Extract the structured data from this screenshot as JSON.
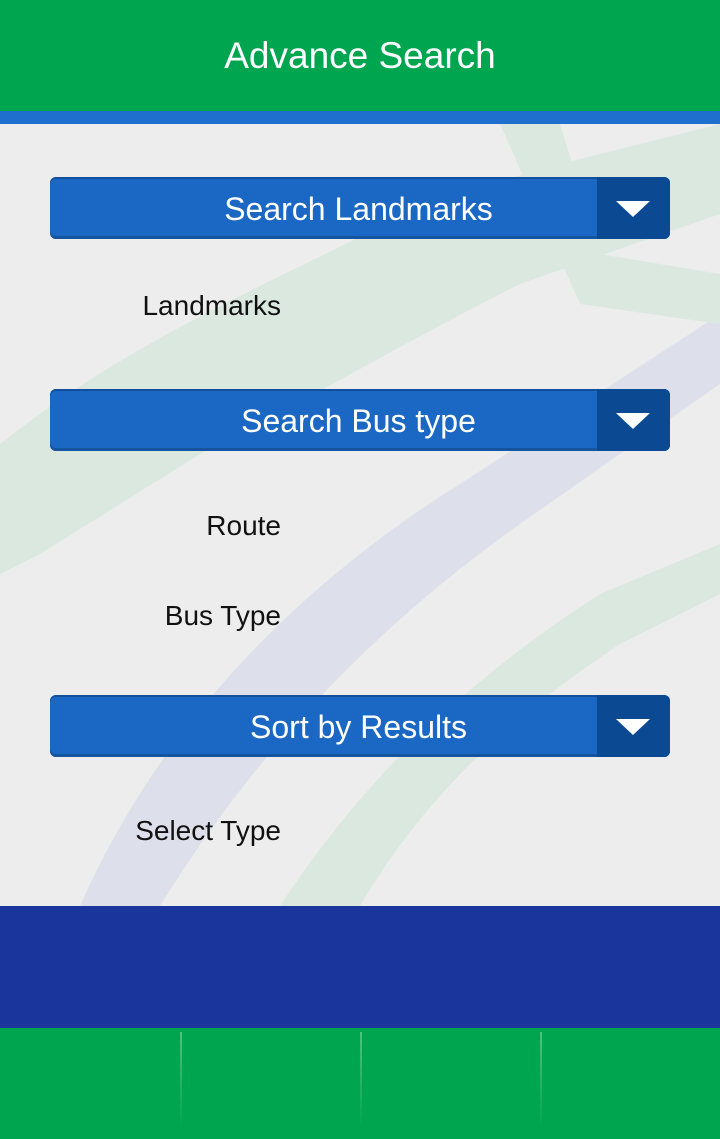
{
  "header": {
    "title": "Advance Search"
  },
  "sections": [
    {
      "dropdown_label": "Search Landmarks",
      "fields": [
        "Landmarks"
      ]
    },
    {
      "dropdown_label": "Search Bus type",
      "fields": [
        "Route",
        "Bus Type"
      ]
    },
    {
      "dropdown_label": "Sort by Results",
      "fields": [
        "Select Type"
      ]
    }
  ],
  "colors": {
    "header": "#00a54f",
    "stripe": "#1e6fce",
    "dropdown": "#1b68c4",
    "dropdown_arrow": "#0b4a93",
    "band": "#1a359b",
    "footer": "#00a54f"
  }
}
